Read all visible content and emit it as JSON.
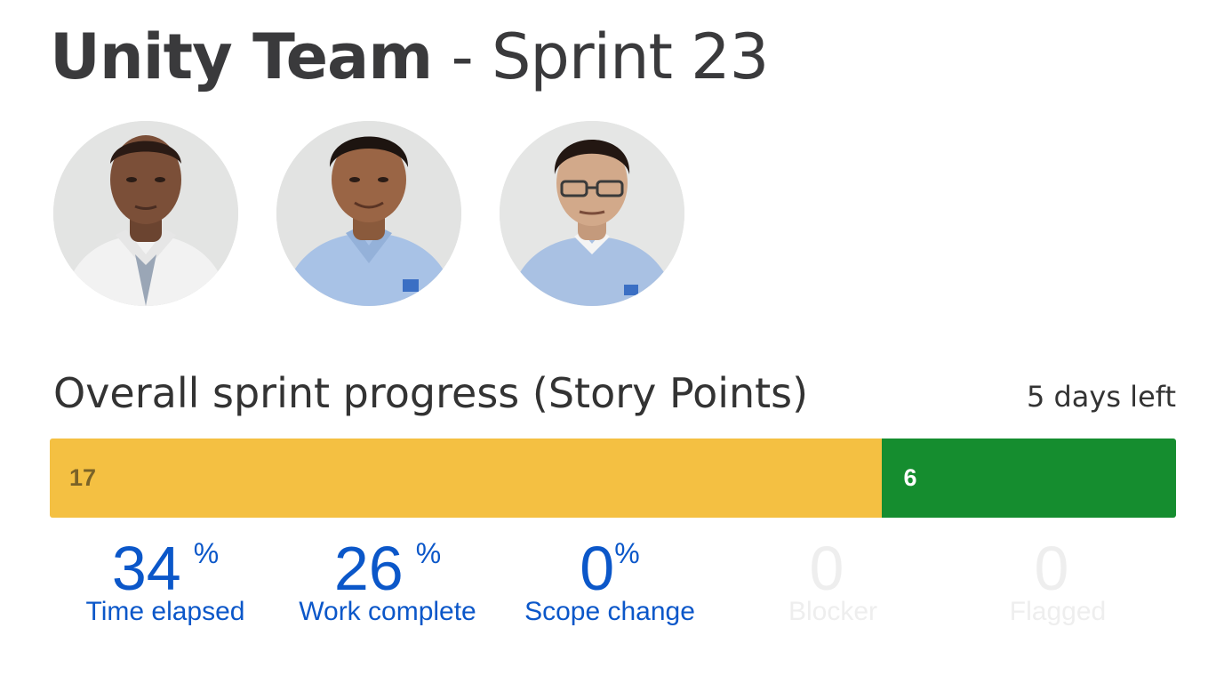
{
  "header": {
    "team_name": "Unity Team",
    "separator": " - ",
    "sprint_name": "Sprint 23"
  },
  "team_members": [
    {
      "avatar_icon": "person-photo-white-shirt"
    },
    {
      "avatar_icon": "person-photo-blue-shirt"
    },
    {
      "avatar_icon": "person-photo-glasses"
    }
  ],
  "progress": {
    "heading": "Overall sprint progress (Story Points)",
    "days_left": "5 days left",
    "segments": [
      {
        "label": "17",
        "value": 17,
        "color": "#f4c042"
      },
      {
        "label": "6",
        "value": 6,
        "color": "#158d2f"
      }
    ]
  },
  "stats": [
    {
      "value": "34",
      "unit": "%",
      "label": "Time elapsed",
      "state": "active"
    },
    {
      "value": "26",
      "unit": "%",
      "label": "Work complete",
      "state": "active"
    },
    {
      "value": "0",
      "unit": "%",
      "label": "Scope change",
      "state": "active"
    },
    {
      "value": "0",
      "unit": "",
      "label": "Blocker",
      "state": "muted"
    },
    {
      "value": "0",
      "unit": "",
      "label": "Flagged",
      "state": "muted"
    }
  ],
  "colors": {
    "accent_blue": "#0b57c9",
    "todo_yellow": "#f4c042",
    "done_green": "#158d2f",
    "muted_text": "#eeeeee",
    "title_text": "#3a3a3c"
  }
}
